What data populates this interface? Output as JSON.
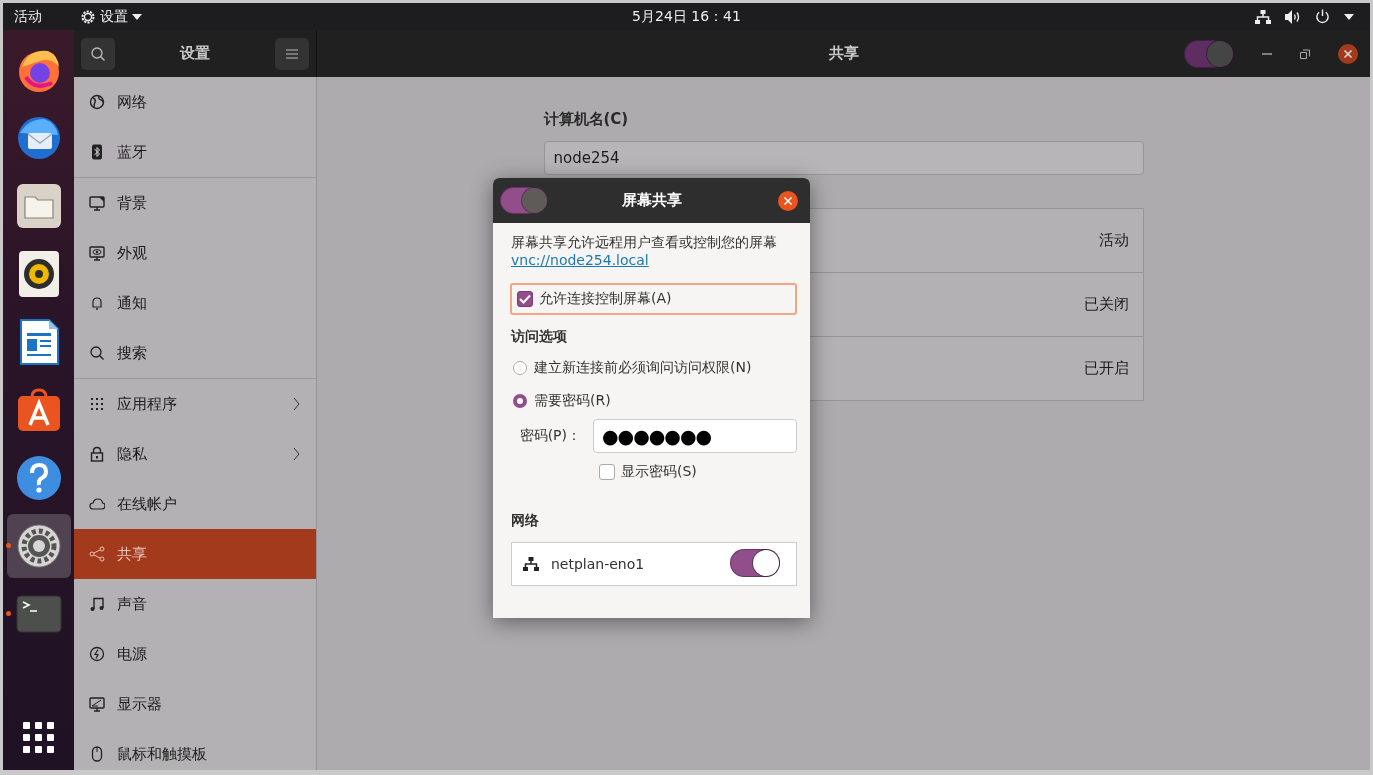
{
  "top_bar": {
    "activities": "活动",
    "app_menu": "设置",
    "clock": "5月24日  16：41"
  },
  "dock": {
    "items": [
      {
        "kind": "firefox",
        "running": false,
        "selected": false
      },
      {
        "kind": "mail",
        "running": false,
        "selected": false
      },
      {
        "kind": "files",
        "running": false,
        "selected": false
      },
      {
        "kind": "music",
        "running": false,
        "selected": false
      },
      {
        "kind": "writer",
        "running": false,
        "selected": false
      },
      {
        "kind": "store",
        "running": false,
        "selected": false
      },
      {
        "kind": "help",
        "running": false,
        "selected": false
      },
      {
        "kind": "settings",
        "running": true,
        "selected": true
      },
      {
        "kind": "terminal",
        "running": true,
        "selected": false
      }
    ]
  },
  "header": {
    "sidebar_title": "设置",
    "title": "共享",
    "sharing_on": true
  },
  "sidebar": {
    "groups": [
      {
        "items": [
          {
            "kind": "globe",
            "label": "网络",
            "submenu": false,
            "selected": false
          },
          {
            "kind": "bluetooth",
            "label": "蓝牙",
            "submenu": false,
            "selected": false
          }
        ]
      },
      {
        "items": [
          {
            "kind": "monitor",
            "label": "背景",
            "submenu": false,
            "selected": false
          },
          {
            "kind": "appearance",
            "label": "外观",
            "submenu": false,
            "selected": false
          },
          {
            "kind": "bell",
            "label": "通知",
            "submenu": false,
            "selected": false
          },
          {
            "kind": "search",
            "label": "搜索",
            "submenu": false,
            "selected": false
          }
        ]
      },
      {
        "items": [
          {
            "kind": "grid",
            "label": "应用程序",
            "submenu": true,
            "selected": false
          },
          {
            "kind": "lock",
            "label": "隐私",
            "submenu": true,
            "selected": false
          },
          {
            "kind": "cloud",
            "label": "在线帐户",
            "submenu": false,
            "selected": false
          },
          {
            "kind": "share",
            "label": "共享",
            "submenu": false,
            "selected": true
          },
          {
            "kind": "music",
            "label": "声音",
            "submenu": false,
            "selected": false
          },
          {
            "kind": "power",
            "label": "电源",
            "submenu": false,
            "selected": false
          },
          {
            "kind": "display",
            "label": "显示器",
            "submenu": false,
            "selected": false
          },
          {
            "kind": "mouse",
            "label": "鼠标和触摸板",
            "submenu": false,
            "selected": false
          }
        ]
      }
    ]
  },
  "content": {
    "computer_name_label": "计算机名(C)",
    "computer_name": "node254",
    "services": [
      {
        "status": "活动"
      },
      {
        "status": "已关闭"
      },
      {
        "status": "已开启"
      }
    ]
  },
  "dialog": {
    "title": "屏幕共享",
    "on": true,
    "description": "屏幕共享允许远程用户查看或控制您的屏幕",
    "link": "vnc://node254.local",
    "allow_control": {
      "label": "允许连接控制屏幕(A)",
      "checked": true
    },
    "access_heading": "访问选项",
    "access_options": [
      {
        "label": "建立新连接前必须询问访问权限(N)",
        "selected": false
      },
      {
        "label": "需要密码(R)",
        "selected": true
      }
    ],
    "password_label": "密码(P)：",
    "password": "●●●●●●●",
    "show_password": {
      "label": "显示密码(S)",
      "checked": false
    },
    "network_heading": "网络",
    "networks": [
      {
        "name": "netplan-eno1",
        "on": true
      }
    ]
  }
}
